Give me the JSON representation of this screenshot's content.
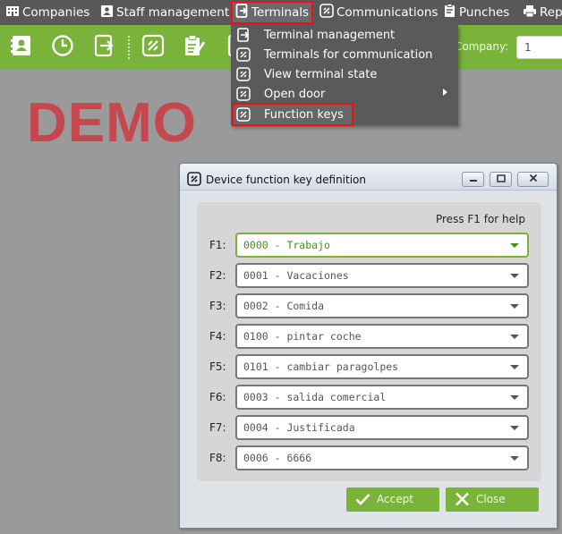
{
  "menubar": {
    "items": [
      {
        "label": "Companies",
        "icon": "building-icon"
      },
      {
        "label": "Staff management",
        "icon": "id-card-icon"
      },
      {
        "label": "Terminals",
        "icon": "terminal-icon"
      },
      {
        "label": "Communications",
        "icon": "link-icon"
      },
      {
        "label": "Punches",
        "icon": "clipboard-icon"
      },
      {
        "label": "Repo",
        "icon": "printer-icon"
      }
    ]
  },
  "toolbar": {
    "company_label": "Company:",
    "company_value": "1",
    "icons": [
      "contacts-icon",
      "clock-icon",
      "terminal-icon",
      "link-icon",
      "clipboard-icon",
      "terminal-icon"
    ]
  },
  "workspace": {
    "watermark": "DEMO"
  },
  "dropdown": {
    "items": [
      {
        "label": "Terminal management",
        "icon": "terminal-icon"
      },
      {
        "label": "Terminals for communication",
        "icon": "link-icon"
      },
      {
        "label": "View terminal state",
        "icon": "link-icon"
      },
      {
        "label": "Open door",
        "icon": "link-icon"
      },
      {
        "label": "Function keys",
        "icon": "link-icon"
      }
    ]
  },
  "dialog": {
    "title": "Device function key definition",
    "help": "Press F1 for help",
    "rows": [
      {
        "key": "F1:",
        "value": "0000 - Trabajo"
      },
      {
        "key": "F2:",
        "value": "0001 - Vacaciones"
      },
      {
        "key": "F3:",
        "value": "0002 - Comida"
      },
      {
        "key": "F4:",
        "value": "0100 - pintar coche"
      },
      {
        "key": "F5:",
        "value": "0101 - cambiar paragolpes"
      },
      {
        "key": "F6:",
        "value": "0003 - salida comercial"
      },
      {
        "key": "F7:",
        "value": "0004 - Justificada"
      },
      {
        "key": "F8:",
        "value": "0006 - 6666"
      }
    ],
    "accept_label": "Accept",
    "close_label": "Close"
  },
  "colors": {
    "accent_green": "#7ab33a",
    "menu_dark": "#595959",
    "highlight_red": "#e11111",
    "watermark_red": "#c6474e"
  }
}
